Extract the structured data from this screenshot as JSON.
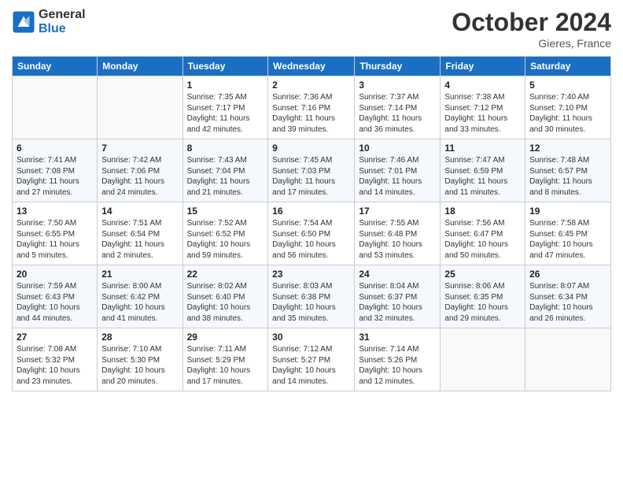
{
  "header": {
    "logo_line1": "General",
    "logo_line2": "Blue",
    "month": "October 2024",
    "location": "Gieres, France"
  },
  "weekdays": [
    "Sunday",
    "Monday",
    "Tuesday",
    "Wednesday",
    "Thursday",
    "Friday",
    "Saturday"
  ],
  "weeks": [
    [
      {
        "day": "",
        "info": ""
      },
      {
        "day": "",
        "info": ""
      },
      {
        "day": "1",
        "info": "Sunrise: 7:35 AM\nSunset: 7:17 PM\nDaylight: 11 hours and 42 minutes."
      },
      {
        "day": "2",
        "info": "Sunrise: 7:36 AM\nSunset: 7:16 PM\nDaylight: 11 hours and 39 minutes."
      },
      {
        "day": "3",
        "info": "Sunrise: 7:37 AM\nSunset: 7:14 PM\nDaylight: 11 hours and 36 minutes."
      },
      {
        "day": "4",
        "info": "Sunrise: 7:38 AM\nSunset: 7:12 PM\nDaylight: 11 hours and 33 minutes."
      },
      {
        "day": "5",
        "info": "Sunrise: 7:40 AM\nSunset: 7:10 PM\nDaylight: 11 hours and 30 minutes."
      }
    ],
    [
      {
        "day": "6",
        "info": "Sunrise: 7:41 AM\nSunset: 7:08 PM\nDaylight: 11 hours and 27 minutes."
      },
      {
        "day": "7",
        "info": "Sunrise: 7:42 AM\nSunset: 7:06 PM\nDaylight: 11 hours and 24 minutes."
      },
      {
        "day": "8",
        "info": "Sunrise: 7:43 AM\nSunset: 7:04 PM\nDaylight: 11 hours and 21 minutes."
      },
      {
        "day": "9",
        "info": "Sunrise: 7:45 AM\nSunset: 7:03 PM\nDaylight: 11 hours and 17 minutes."
      },
      {
        "day": "10",
        "info": "Sunrise: 7:46 AM\nSunset: 7:01 PM\nDaylight: 11 hours and 14 minutes."
      },
      {
        "day": "11",
        "info": "Sunrise: 7:47 AM\nSunset: 6:59 PM\nDaylight: 11 hours and 11 minutes."
      },
      {
        "day": "12",
        "info": "Sunrise: 7:48 AM\nSunset: 6:57 PM\nDaylight: 11 hours and 8 minutes."
      }
    ],
    [
      {
        "day": "13",
        "info": "Sunrise: 7:50 AM\nSunset: 6:55 PM\nDaylight: 11 hours and 5 minutes."
      },
      {
        "day": "14",
        "info": "Sunrise: 7:51 AM\nSunset: 6:54 PM\nDaylight: 11 hours and 2 minutes."
      },
      {
        "day": "15",
        "info": "Sunrise: 7:52 AM\nSunset: 6:52 PM\nDaylight: 10 hours and 59 minutes."
      },
      {
        "day": "16",
        "info": "Sunrise: 7:54 AM\nSunset: 6:50 PM\nDaylight: 10 hours and 56 minutes."
      },
      {
        "day": "17",
        "info": "Sunrise: 7:55 AM\nSunset: 6:48 PM\nDaylight: 10 hours and 53 minutes."
      },
      {
        "day": "18",
        "info": "Sunrise: 7:56 AM\nSunset: 6:47 PM\nDaylight: 10 hours and 50 minutes."
      },
      {
        "day": "19",
        "info": "Sunrise: 7:58 AM\nSunset: 6:45 PM\nDaylight: 10 hours and 47 minutes."
      }
    ],
    [
      {
        "day": "20",
        "info": "Sunrise: 7:59 AM\nSunset: 6:43 PM\nDaylight: 10 hours and 44 minutes."
      },
      {
        "day": "21",
        "info": "Sunrise: 8:00 AM\nSunset: 6:42 PM\nDaylight: 10 hours and 41 minutes."
      },
      {
        "day": "22",
        "info": "Sunrise: 8:02 AM\nSunset: 6:40 PM\nDaylight: 10 hours and 38 minutes."
      },
      {
        "day": "23",
        "info": "Sunrise: 8:03 AM\nSunset: 6:38 PM\nDaylight: 10 hours and 35 minutes."
      },
      {
        "day": "24",
        "info": "Sunrise: 8:04 AM\nSunset: 6:37 PM\nDaylight: 10 hours and 32 minutes."
      },
      {
        "day": "25",
        "info": "Sunrise: 8:06 AM\nSunset: 6:35 PM\nDaylight: 10 hours and 29 minutes."
      },
      {
        "day": "26",
        "info": "Sunrise: 8:07 AM\nSunset: 6:34 PM\nDaylight: 10 hours and 26 minutes."
      }
    ],
    [
      {
        "day": "27",
        "info": "Sunrise: 7:08 AM\nSunset: 5:32 PM\nDaylight: 10 hours and 23 minutes."
      },
      {
        "day": "28",
        "info": "Sunrise: 7:10 AM\nSunset: 5:30 PM\nDaylight: 10 hours and 20 minutes."
      },
      {
        "day": "29",
        "info": "Sunrise: 7:11 AM\nSunset: 5:29 PM\nDaylight: 10 hours and 17 minutes."
      },
      {
        "day": "30",
        "info": "Sunrise: 7:12 AM\nSunset: 5:27 PM\nDaylight: 10 hours and 14 minutes."
      },
      {
        "day": "31",
        "info": "Sunrise: 7:14 AM\nSunset: 5:26 PM\nDaylight: 10 hours and 12 minutes."
      },
      {
        "day": "",
        "info": ""
      },
      {
        "day": "",
        "info": ""
      }
    ]
  ]
}
